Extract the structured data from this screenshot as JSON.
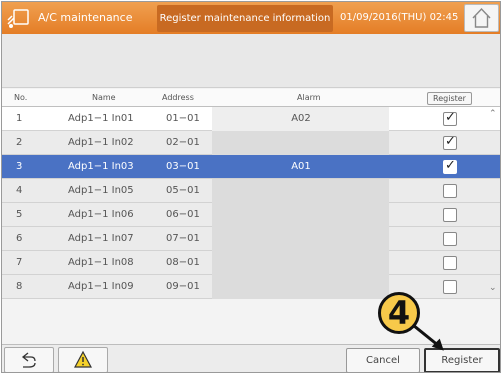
{
  "header": {
    "title": "A/C maintenance",
    "tab_label": "Register maintenance information",
    "datetime": "01/09/2016(THU) 02:45",
    "app_icon": "ac-unit-icon",
    "home_icon": "home-icon"
  },
  "table": {
    "columns": {
      "no": "No.",
      "name": "Name",
      "address": "Address",
      "alarm": "Alarm",
      "register": "Register"
    },
    "rows": [
      {
        "no": "1",
        "name": "Adp1−1 In01",
        "address": "01−01",
        "alarm": "A02",
        "checked": true
      },
      {
        "no": "2",
        "name": "Adp1−1 In02",
        "address": "02−01",
        "alarm": "",
        "checked": true
      },
      {
        "no": "3",
        "name": "Adp1−1 In03",
        "address": "03−01",
        "alarm": "A01",
        "checked": true
      },
      {
        "no": "4",
        "name": "Adp1−1 In05",
        "address": "05−01",
        "alarm": "",
        "checked": false
      },
      {
        "no": "5",
        "name": "Adp1−1 In06",
        "address": "06−01",
        "alarm": "",
        "checked": false
      },
      {
        "no": "6",
        "name": "Adp1−1 In07",
        "address": "07−01",
        "alarm": "",
        "checked": false
      },
      {
        "no": "7",
        "name": "Adp1−1 In08",
        "address": "08−01",
        "alarm": "",
        "checked": false
      },
      {
        "no": "8",
        "name": "Adp1−1 In09",
        "address": "09−01",
        "alarm": "",
        "checked": false
      }
    ],
    "selected_row": 3,
    "checkmark_glyph": "✓"
  },
  "footer": {
    "back_icon": "back-arrow-icon",
    "warning_icon": "warning-icon",
    "cancel_label": "Cancel",
    "register_label": "Register"
  },
  "callout": {
    "step_label": "4"
  },
  "colors": {
    "header": "#e47d26",
    "header_tab": "#c86a22",
    "selected_row": "#4a72c4",
    "callout": "#f7c94a"
  }
}
